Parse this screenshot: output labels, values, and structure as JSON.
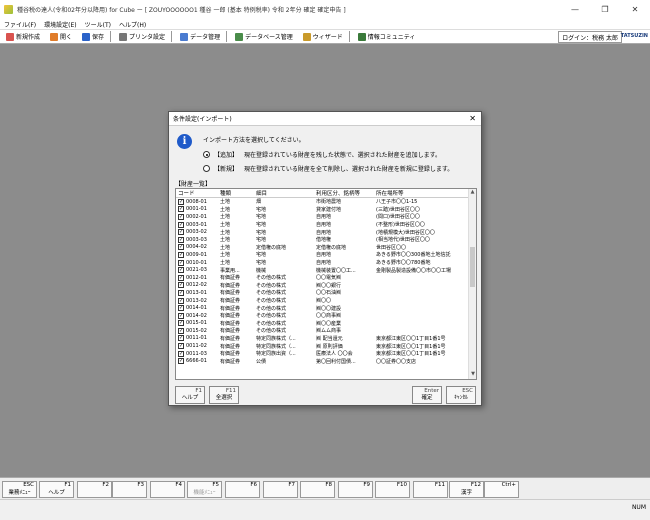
{
  "window": {
    "title": "種谷税の達人(令和02年分以降用) for Cube ー [ ZOUYOOOOOO1 種谷 一郎 (基本 特例税率) 令和 2年分 確定 確定申告 ]",
    "controls": [
      "—",
      "❐",
      "✕"
    ]
  },
  "menu": [
    "ファイル(F)",
    "環境設定(E)",
    "ツール(T)",
    "ヘルプ(H)"
  ],
  "toolbar": {
    "buttons": [
      {
        "label": "新規作成",
        "icon_color": "#d9534f"
      },
      {
        "label": "開く",
        "icon_color": "#e07c2a"
      },
      {
        "label": "保存",
        "icon_color": "#2a62c9"
      },
      {
        "label": "プリンタ設定",
        "icon_color": "#777777"
      },
      {
        "label": "データ管理",
        "icon_color": "#4a7bd0"
      },
      {
        "label": "データベース管理",
        "icon_color": "#4a8c4a"
      },
      {
        "label": "ウィザード",
        "icon_color": "#c99a2a"
      },
      {
        "label": "情報コミュニティ",
        "icon_color": "#3a7a3a"
      }
    ],
    "login": "ログイン：税務 太郎",
    "brand": "TATSUZIN"
  },
  "dialog": {
    "title": "条件設定(インポート)",
    "close": "✕",
    "prompt": "インポート方法を選択してください。",
    "options": [
      {
        "label": "【追加】",
        "desc": "現在登録されている財産を残した状態で、選択された財産を追加します。",
        "selected": true
      },
      {
        "label": "【新規】",
        "desc": "現在登録されている財産を全て削除し、選択された財産を新規に登録します。",
        "selected": false
      }
    ],
    "list_caption": "【財産一覧】",
    "columns": [
      "コード",
      "種類",
      "細目",
      "利用区分、銘柄等",
      "所在場所等"
    ],
    "rows": [
      [
        "0008-01",
        "土地",
        "畑",
        "市街地農地",
        "八王子市〇〇1-15"
      ],
      [
        "0001-01",
        "土地",
        "宅地",
        "貸家建付地",
        "(三踏)世田谷区〇〇"
      ],
      [
        "0002-01",
        "土地",
        "宅地",
        "自用地",
        "(間口)世田谷区〇〇"
      ],
      [
        "0003-01",
        "土地",
        "宅地",
        "自用地",
        "(不整形)世田谷区〇〇"
      ],
      [
        "0003-02",
        "土地",
        "宅地",
        "自用地",
        "(地積規模大)世田谷区〇〇"
      ],
      [
        "0003-03",
        "土地",
        "宅地",
        "借地権",
        "(相当地代)世田谷区〇〇"
      ],
      [
        "0004-02",
        "土地",
        "定借権の底地",
        "定借権の底地",
        "世田谷区〇〇"
      ],
      [
        "0009-01",
        "土地",
        "宅地",
        "自用地",
        "あきる野市〇〇300番地土地信託"
      ],
      [
        "0010-01",
        "土地",
        "宅地",
        "自用地",
        "あきる野市〇〇780番地"
      ],
      [
        "0021-03",
        "事業用...",
        "機械",
        "機械装置〇〇工...",
        "金剛製品製造設備〇〇市〇〇工場"
      ],
      [
        "0012-01",
        "有価証券",
        "その他の株式",
        "〇〇電気㈱",
        ""
      ],
      [
        "0012-02",
        "有価証券",
        "その他の株式",
        "㈱〇〇銀行",
        ""
      ],
      [
        "0013-01",
        "有価証券",
        "その他の株式",
        "〇〇石油㈱",
        ""
      ],
      [
        "0013-02",
        "有価証券",
        "その他の株式",
        "㈱〇〇",
        ""
      ],
      [
        "0014-01",
        "有価証券",
        "その他の株式",
        "㈱〇〇建設",
        ""
      ],
      [
        "0014-02",
        "有価証券",
        "その他の株式",
        "〇〇商事㈱",
        ""
      ],
      [
        "0015-01",
        "有価証券",
        "その他の株式",
        "㈱〇〇産業",
        ""
      ],
      [
        "0015-02",
        "有価証券",
        "その他の株式",
        "㈱ムム商事",
        ""
      ],
      [
        "0011-01",
        "有価証券",
        "特定同族株式（...",
        "㈱ 配当還元",
        "東京都江東区〇〇1丁目1番1号"
      ],
      [
        "0011-02",
        "有価証券",
        "特定同族株式（...",
        "㈱ 原則評価",
        "東京都江東区〇〇1丁目1番1号"
      ],
      [
        "0011-03",
        "有価証券",
        "特定同族出資（...",
        "医療法人 〇〇会",
        "東京都江東区〇〇1丁目1番1号"
      ],
      [
        "6666-01",
        "有価証券",
        "公債",
        "第〇回利付国債...",
        "〇〇証券〇〇支店"
      ]
    ],
    "buttons": [
      {
        "key": "F1",
        "label": "ヘルプ"
      },
      {
        "key": "F11",
        "label": "全選択"
      },
      {
        "key": "Enter",
        "label": "確定"
      },
      {
        "key": "ESC",
        "label": "ｷｬﾝｾﾙ"
      }
    ]
  },
  "fkeys": [
    {
      "key": "ESC",
      "label": "業務ﾒﾆｭｰ",
      "enabled": true
    },
    {
      "key": "F1",
      "label": "ヘルプ",
      "enabled": true
    },
    {
      "key": "F2",
      "label": "",
      "enabled": true
    },
    {
      "key": "F3",
      "label": "",
      "enabled": true
    },
    {
      "key": "F4",
      "label": "",
      "enabled": true
    },
    {
      "key": "F5",
      "label": "機能ﾒﾆｭｰ",
      "enabled": false
    },
    {
      "key": "F6",
      "label": "",
      "enabled": true
    },
    {
      "key": "F7",
      "label": "",
      "enabled": true
    },
    {
      "key": "F8",
      "label": "",
      "enabled": true
    },
    {
      "key": "F9",
      "label": "",
      "enabled": true
    },
    {
      "key": "F10",
      "label": "",
      "enabled": true
    },
    {
      "key": "F11",
      "label": "",
      "enabled": true
    },
    {
      "key": "F12",
      "label": "漢字",
      "enabled": true
    },
    {
      "key": "Ctrl+",
      "label": "",
      "enabled": true
    }
  ],
  "status": {
    "num": "NUM"
  }
}
